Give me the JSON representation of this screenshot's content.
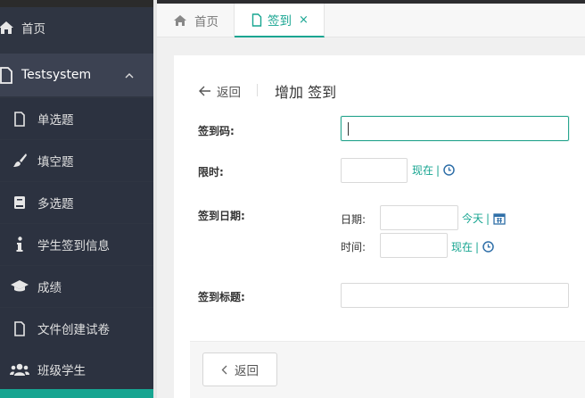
{
  "sidebar": {
    "home": {
      "label": "首页",
      "icon": "home-icon"
    },
    "group": {
      "label": "Testsystem",
      "icon": "file-icon",
      "caret": "^"
    },
    "items": [
      {
        "label": "单选题",
        "icon": "file-icon"
      },
      {
        "label": "填空题",
        "icon": "brush-icon"
      },
      {
        "label": "多选题",
        "icon": "book-icon"
      },
      {
        "label": "学生签到信息",
        "icon": "info-icon"
      },
      {
        "label": "成绩",
        "icon": "graduation-cap-icon"
      },
      {
        "label": "文件创建试卷",
        "icon": "file-icon"
      },
      {
        "label": "班级学生",
        "icon": "users-icon"
      }
    ]
  },
  "tabs": {
    "home": {
      "label": "首页"
    },
    "active": {
      "label": "签到",
      "close": "×"
    }
  },
  "form": {
    "back_label": "返回",
    "title": "增加 签到",
    "code_label": "签到码:",
    "limit_label": "限时:",
    "limit_now": "现在",
    "date_label": "签到日期:",
    "date_sub_label": "日期:",
    "date_today": "今天",
    "time_sub_label": "时间:",
    "time_now": "现在",
    "title_label": "签到标题:",
    "separator": "|"
  },
  "footer": {
    "back_button": "返回"
  },
  "colors": {
    "accent": "#17a591",
    "sidebar": "#2f3542"
  }
}
